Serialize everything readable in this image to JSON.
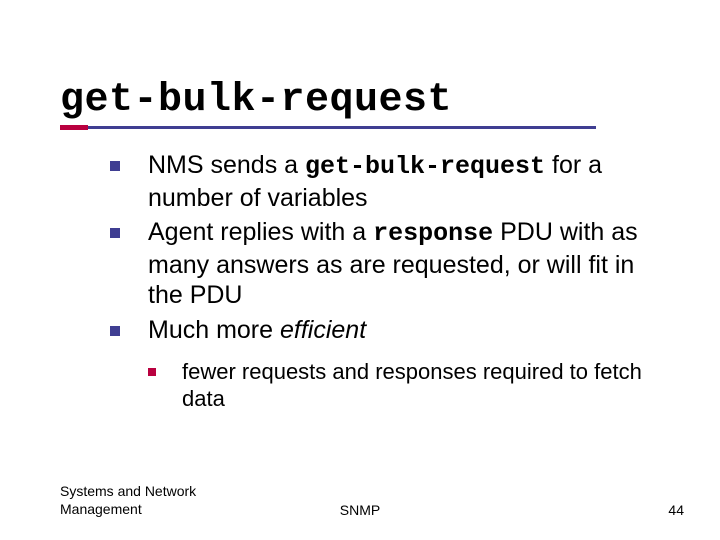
{
  "title": "get-bulk-request",
  "bullets": [
    {
      "parts": {
        "p0": "NMS sends a ",
        "code0": "get-bulk-request",
        "p1": " for a number of variables"
      }
    },
    {
      "parts": {
        "p0": "Agent replies with a ",
        "code0": "response",
        "p1": " PDU with as many answers as are requested, or will fit  in the PDU"
      }
    },
    {
      "parts": {
        "p0": "Much more ",
        "em0": "efficient"
      }
    }
  ],
  "sub_bullets": [
    "fewer requests and responses required to fetch data"
  ],
  "footer": {
    "left_line1": "Systems and Network",
    "left_line2": "Management",
    "center": "SNMP",
    "right": "44"
  }
}
